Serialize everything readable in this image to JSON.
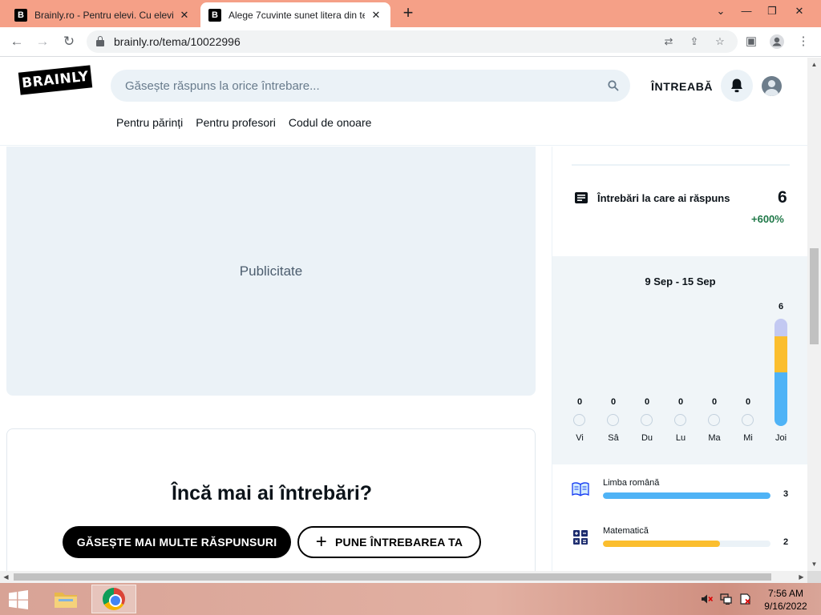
{
  "browser": {
    "tabs": [
      {
        "title": "Brainly.ro - Pentru elevi. Cu elevi.",
        "favicon": "B",
        "active": false
      },
      {
        "title": "Alege 7cuvinte sunet litera din te",
        "favicon": "B",
        "active": true
      }
    ],
    "new_tab": "+",
    "url": "brainly.ro/tema/10022996"
  },
  "site": {
    "logo_text": "BRAINLY",
    "search": {
      "placeholder": "Găsește răspuns la orice întrebare..."
    },
    "ask_label": "ÎNTREABĂ",
    "subnav": [
      "Pentru părinți",
      "Pentru profesori",
      "Codul de onoare"
    ]
  },
  "main": {
    "ad_label": "Publicitate",
    "questions_title": "Încă mai ai întrebări?",
    "find_more_label": "GĂSEȘTE MAI MULTE RĂSPUNSURI",
    "ask_question_label": "PUNE ÎNTREBAREA TA"
  },
  "sidebar": {
    "stat_label": "Întrebări la care ai răspuns",
    "stat_value": "6",
    "stat_change": "+600%",
    "week_range": "9 Sep - 15 Sep",
    "days": [
      {
        "label": "Vi",
        "count": "0"
      },
      {
        "label": "Sâ",
        "count": "0"
      },
      {
        "label": "Du",
        "count": "0"
      },
      {
        "label": "Lu",
        "count": "0"
      },
      {
        "label": "Ma",
        "count": "0"
      },
      {
        "label": "Mi",
        "count": "0"
      },
      {
        "label": "Joi",
        "count": "6"
      }
    ],
    "today_breakdown": [
      {
        "color": "#c3c9f2",
        "value": 1
      },
      {
        "color": "#fbbe2e",
        "value": 2
      },
      {
        "color": "#4fb3f6",
        "value": 3
      }
    ],
    "subjects": [
      {
        "name": "Limba română",
        "count": "3",
        "fraction": 1.0,
        "color": "#4fb3f6",
        "icon": "book-icon"
      },
      {
        "name": "Matematică",
        "count": "2",
        "fraction": 0.7,
        "color": "#fbbe2e",
        "icon": "calculator-icon"
      }
    ]
  },
  "taskbar": {
    "time": "7:56 AM",
    "date": "9/16/2022"
  }
}
